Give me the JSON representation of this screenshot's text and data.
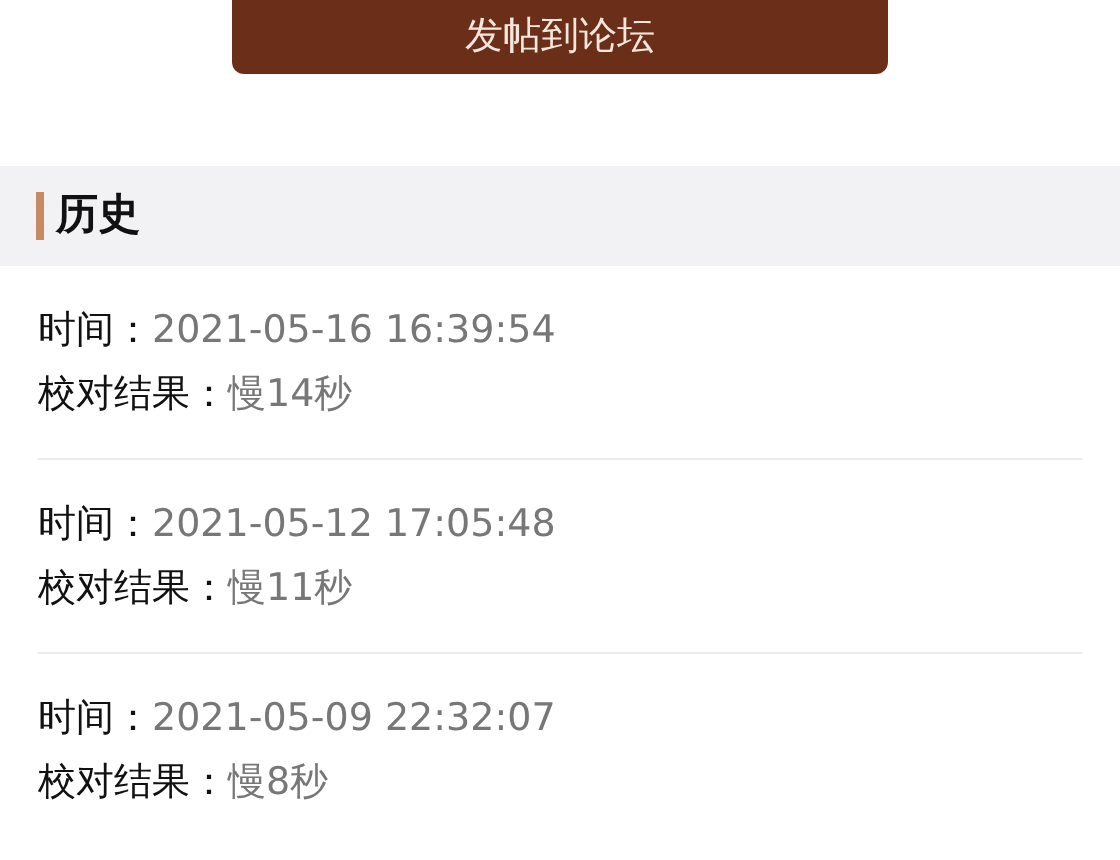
{
  "post_button": {
    "label": "发帖到论坛"
  },
  "history": {
    "title": "历史",
    "entries": [
      {
        "time_label": "时间：",
        "time": "2021-05-16 16:39:54",
        "result_label": "校对结果：",
        "result": "慢14秒"
      },
      {
        "time_label": "时间：",
        "time": "2021-05-12 17:05:48",
        "result_label": "校对结果：",
        "result": "慢11秒"
      },
      {
        "time_label": "时间：",
        "time": "2021-05-09 22:32:07",
        "result_label": "校对结果：",
        "result": "慢8秒"
      }
    ]
  }
}
